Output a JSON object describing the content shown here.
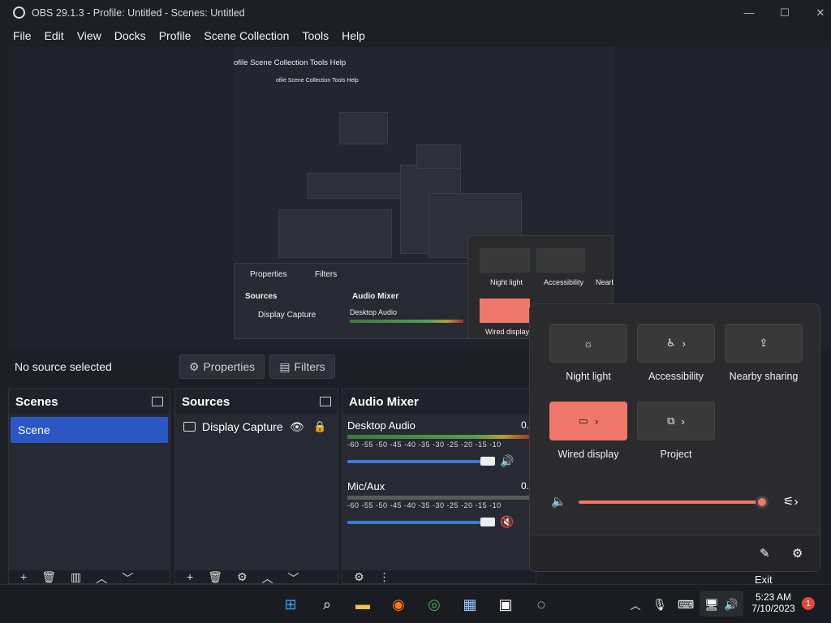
{
  "window": {
    "title": "OBS 29.1.3 - Profile: Untitled - Scenes: Untitled"
  },
  "menu": [
    "File",
    "Edit",
    "View",
    "Docks",
    "Profile",
    "Scene Collection",
    "Tools",
    "Help"
  ],
  "preview_nested": {
    "menu_top": "ofile   Scene Collection   Tools   Help",
    "menu_2": "ofile   Scene Collection   Tools   Help",
    "properties": "Properties",
    "filters": "Filters",
    "sources": "Sources",
    "audio_mixer": "Audio Mixer",
    "display_capture": "Display Capture",
    "desktop_audio": "Desktop Audio",
    "night_light": "Night light",
    "accessibility": "Accessibility",
    "nearby": "Nearb",
    "wired_display": "Wired display"
  },
  "toolbar": {
    "no_source": "No source selected",
    "properties": "Properties",
    "filters": "Filters"
  },
  "scenes": {
    "title": "Scenes",
    "items": [
      "Scene"
    ]
  },
  "sources": {
    "title": "Sources",
    "items": [
      "Display Capture"
    ]
  },
  "mixer": {
    "title": "Audio Mixer",
    "channels": [
      {
        "name": "Desktop Audio",
        "level": "0.",
        "ticks": "-60 -55 -50 -45 -40 -35 -30 -25 -20 -15 -10",
        "muted": false
      },
      {
        "name": "Mic/Aux",
        "level": "0.",
        "ticks": "-60 -55 -50 -45 -40 -35 -30 -25 -20 -15 -10",
        "muted": true
      }
    ]
  },
  "controls": {
    "exit": "Exit"
  },
  "quick_settings": {
    "tiles": [
      {
        "label": "Night light",
        "icon": "brightness-icon",
        "active": false
      },
      {
        "label": "Accessibility",
        "icon": "accessibility-icon",
        "active": false
      },
      {
        "label": "Nearby sharing",
        "icon": "share-icon",
        "active": false
      },
      {
        "label": "Wired display",
        "icon": "cast-icon",
        "active": true
      },
      {
        "label": "Project",
        "icon": "project-icon",
        "active": false
      }
    ],
    "volume_fraction": 0.95,
    "accent": "#f0786a"
  },
  "taskbar": {
    "time": "5:23 AM",
    "date": "7/10/2023",
    "notification_count": "1"
  }
}
